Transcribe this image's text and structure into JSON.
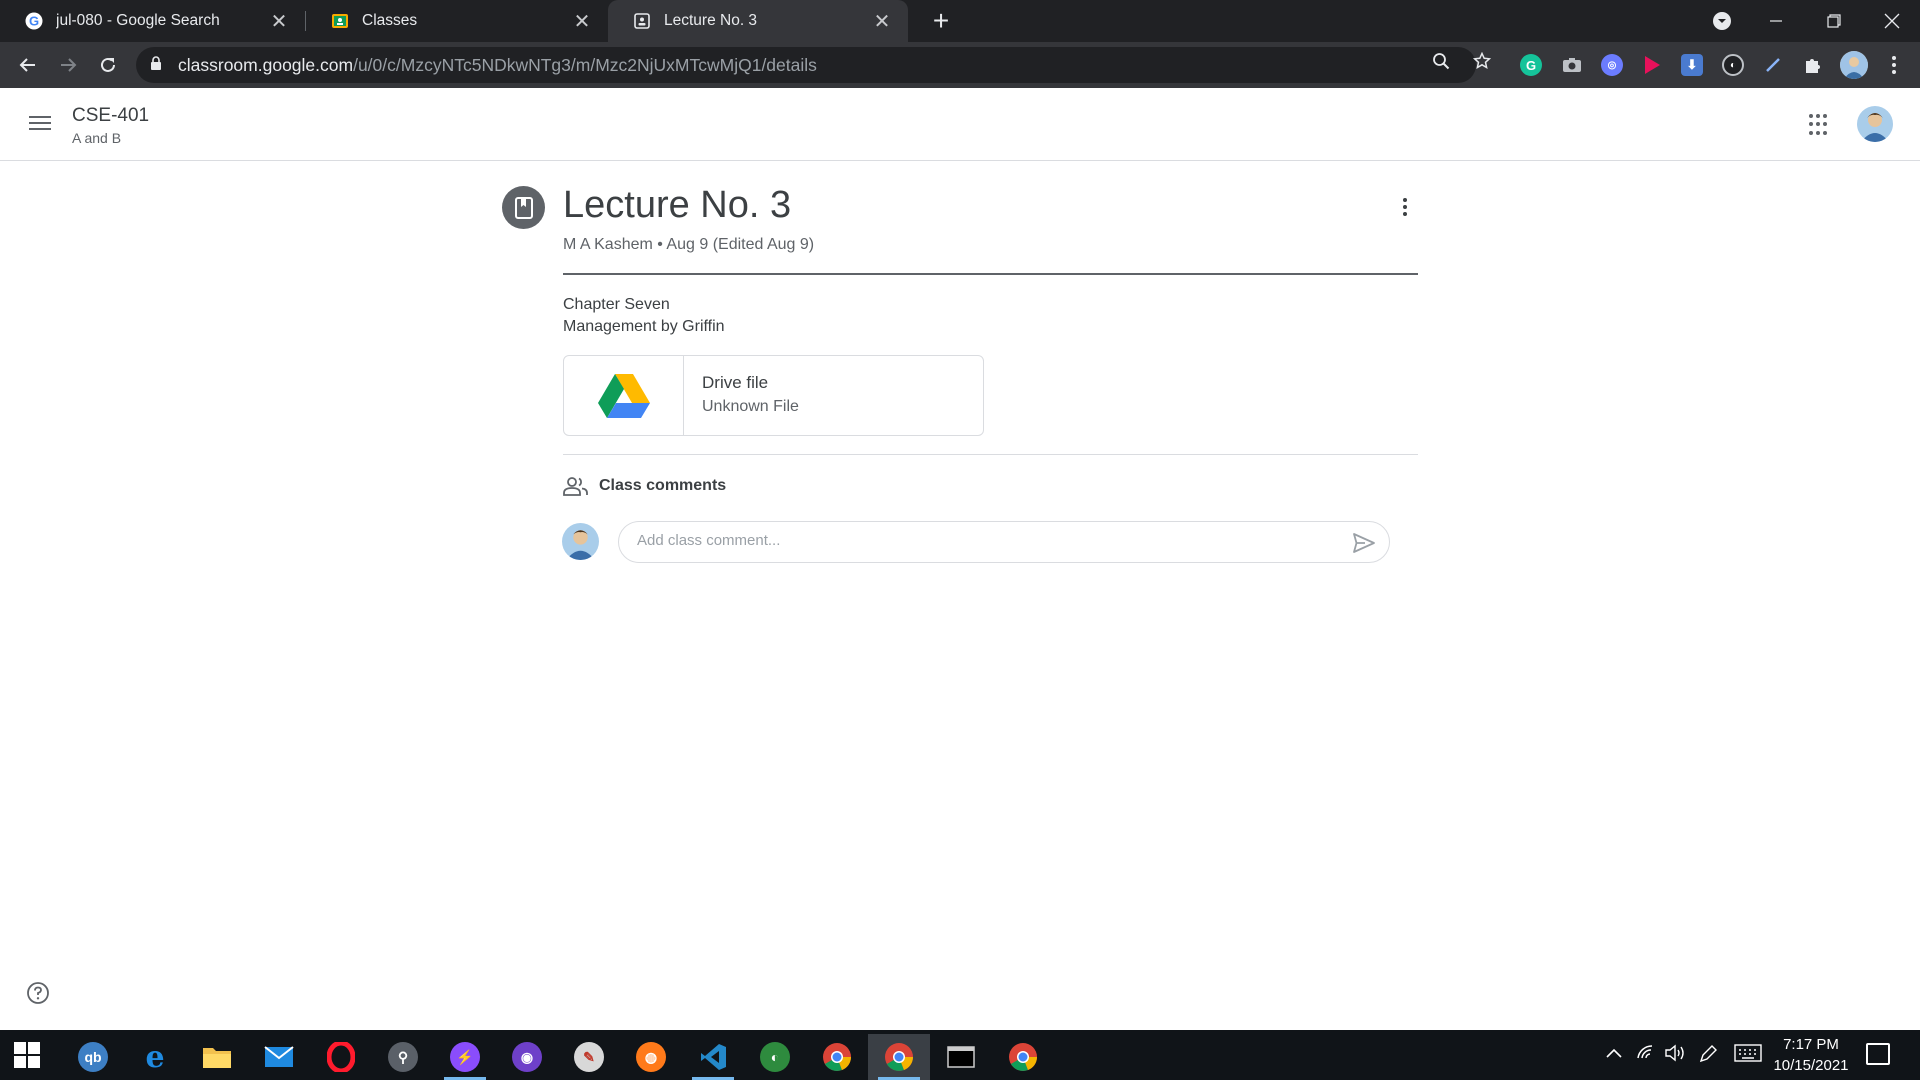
{
  "browser": {
    "tabs": [
      {
        "title": "jul-080 - Google Search",
        "favicon": "google-g-icon"
      },
      {
        "title": "Classes",
        "favicon": "classroom-icon"
      },
      {
        "title": "Lecture No. 3",
        "favicon": "classroom-post-icon"
      }
    ],
    "url_domain": "classroom.google.com",
    "url_path": "/u/0/c/MzcyNTc5NDkwNTg3/m/Mzc2NjUxMTcwMjQ1/details"
  },
  "classroom": {
    "class_name": "CSE-401",
    "class_section": "A and B"
  },
  "post": {
    "title": "Lecture No. 3",
    "meta": "M A Kashem • Aug 9 (Edited Aug 9)",
    "description": [
      "Chapter Seven",
      "Management by Griffin"
    ],
    "attachment": {
      "title": "Drive file",
      "subtitle": "Unknown File",
      "icon": "google-drive-icon"
    }
  },
  "comments": {
    "heading": "Class comments",
    "placeholder": "Add class comment..."
  },
  "taskbar": {
    "time": "7:17 PM",
    "date": "10/15/2021"
  },
  "colors": {
    "chrome_dark": "#202124",
    "chrome_toolbar": "#35363a",
    "text_primary": "#3c4043",
    "text_secondary": "#5f6368",
    "taskbar": "#101418"
  }
}
